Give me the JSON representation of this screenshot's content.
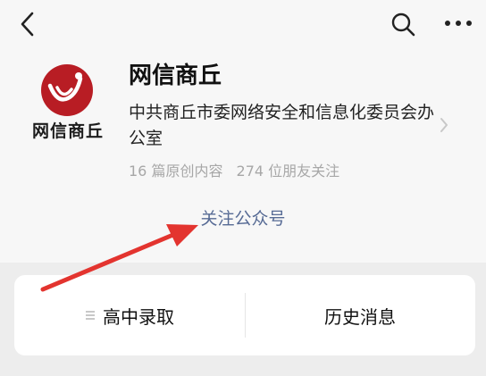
{
  "account": {
    "name": "网信商丘",
    "org": "中共商丘市委网络安全和信息化委员会办公室",
    "stats": {
      "original_articles": "16 篇原创内容",
      "followers": "274 位朋友关注"
    },
    "logo_text": "网信商丘"
  },
  "actions": {
    "follow_label": "关注公众号"
  },
  "menu": [
    {
      "label": "高中录取"
    },
    {
      "label": "历史消息"
    }
  ],
  "icons": {
    "back": "chevron-left-icon",
    "search": "search-icon",
    "more": "more-icon",
    "detail": "chevron-right-icon",
    "menu": "menu-lines-icon"
  },
  "colors": {
    "brand": "#b81d24",
    "link": "#576b95",
    "annotation_arrow": "#e3342f"
  }
}
